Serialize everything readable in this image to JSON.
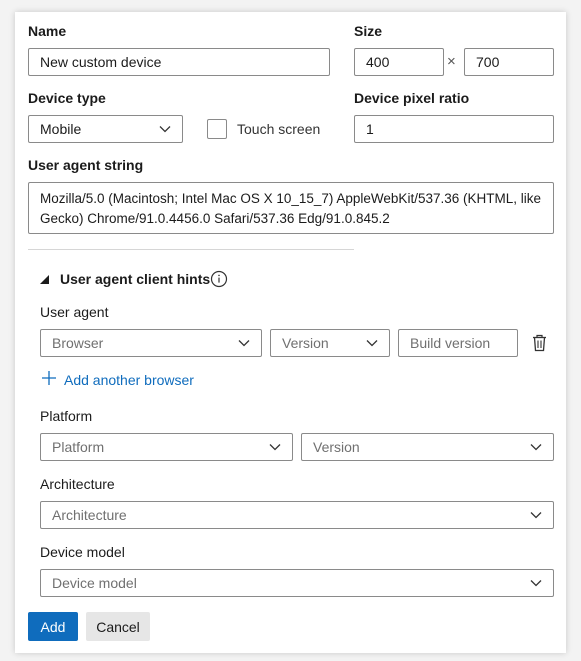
{
  "labels": {
    "name": "Name",
    "size": "Size",
    "size_separator": "×",
    "device_type": "Device type",
    "touch_screen": "Touch screen",
    "device_pixel_ratio": "Device pixel ratio",
    "user_agent_string": "User agent string"
  },
  "values": {
    "name": "New custom device",
    "width": "400",
    "height": "700",
    "device_type": "Mobile",
    "device_pixel_ratio": "1",
    "user_agent_string": "Mozilla/5.0 (Macintosh; Intel Mac OS X 10_15_7) AppleWebKit/537.36 (KHTML, like Gecko) Chrome/91.0.4456.0 Safari/537.36 Edg/91.0.845.2"
  },
  "client_hints": {
    "title": "User agent client hints",
    "user_agent_label": "User agent",
    "browser_placeholder": "Browser",
    "version_placeholder": "Version",
    "build_version_placeholder": "Build version",
    "add_browser": "Add another browser",
    "platform_label": "Platform",
    "platform_placeholder": "Platform",
    "platform_version_placeholder": "Version",
    "architecture_label": "Architecture",
    "architecture_placeholder": "Architecture",
    "device_model_label": "Device model",
    "device_model_placeholder": "Device model"
  },
  "buttons": {
    "add": "Add",
    "cancel": "Cancel"
  },
  "colors": {
    "accent": "#0f6cbd",
    "border": "#8a8a8a"
  }
}
